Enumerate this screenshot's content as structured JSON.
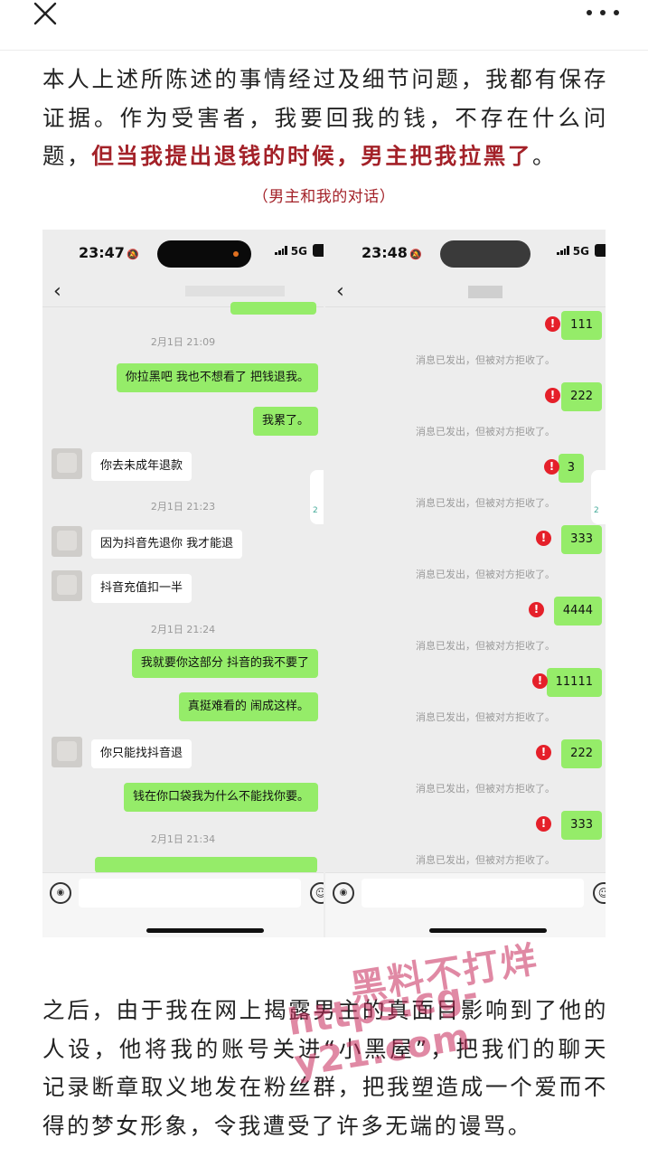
{
  "topbar": {
    "close_icon": "close-icon",
    "more_icon": "more-dots-icon"
  },
  "article": {
    "para1_plain": "本人上述所陈述的事情经过及细节问题，我都有保存证据。作为受害者，我要回我的钱，不存在什么问题，",
    "para1_highlight": "但当我提出退钱的时候，男主把我拉黑了",
    "para1_end": "。",
    "caption": "（男主和我的对话）",
    "para2": "之后，由于我在网上揭露男主的真面目影响到了他的人设，他将我的账号关进“小黑屋”，把我们的聊天记录断章取义地发在粉丝群，把我塑造成一个爱而不得的梦女形象，令我遭受了许多无端的谩骂。"
  },
  "colors": {
    "highlight": "#a32128",
    "bubble_out": "#95ec69",
    "bubble_in": "#ffffff",
    "error": "#e5202a"
  },
  "left_phone": {
    "time": "23:47",
    "network": "5G",
    "messages": [
      {
        "type": "time",
        "text": "2月1日 21:09"
      },
      {
        "type": "out",
        "text": "你拉黑吧 我也不想看了 把钱退我。"
      },
      {
        "type": "out",
        "text": "我累了。"
      },
      {
        "type": "in",
        "text": "你去未成年退款"
      },
      {
        "type": "time",
        "text": "2月1日 21:23"
      },
      {
        "type": "in",
        "text": "因为抖音先退你 我才能退"
      },
      {
        "type": "in",
        "text": "抖音充值扣一半"
      },
      {
        "type": "time",
        "text": "2月1日 21:24"
      },
      {
        "type": "out",
        "text": "我就要你这部分 抖音的我不要了"
      },
      {
        "type": "out",
        "text": "真挺难看的 闹成这样。"
      },
      {
        "type": "in",
        "text": "你只能找抖音退"
      },
      {
        "type": "out",
        "text": "钱在你口袋我为什么不能找你要。"
      },
      {
        "type": "time",
        "text": "2月1日 21:34"
      }
    ]
  },
  "right_phone": {
    "time": "23:48",
    "network": "5G",
    "error_mark": "!",
    "notice": "消息已发出，但被对方拒收了。",
    "messages": [
      "111",
      "222",
      "3",
      "333",
      "4444",
      "11111",
      "222",
      "333"
    ]
  },
  "watermark": {
    "line1": "黑料不打烊",
    "line2": "https:cg-y21.com"
  }
}
